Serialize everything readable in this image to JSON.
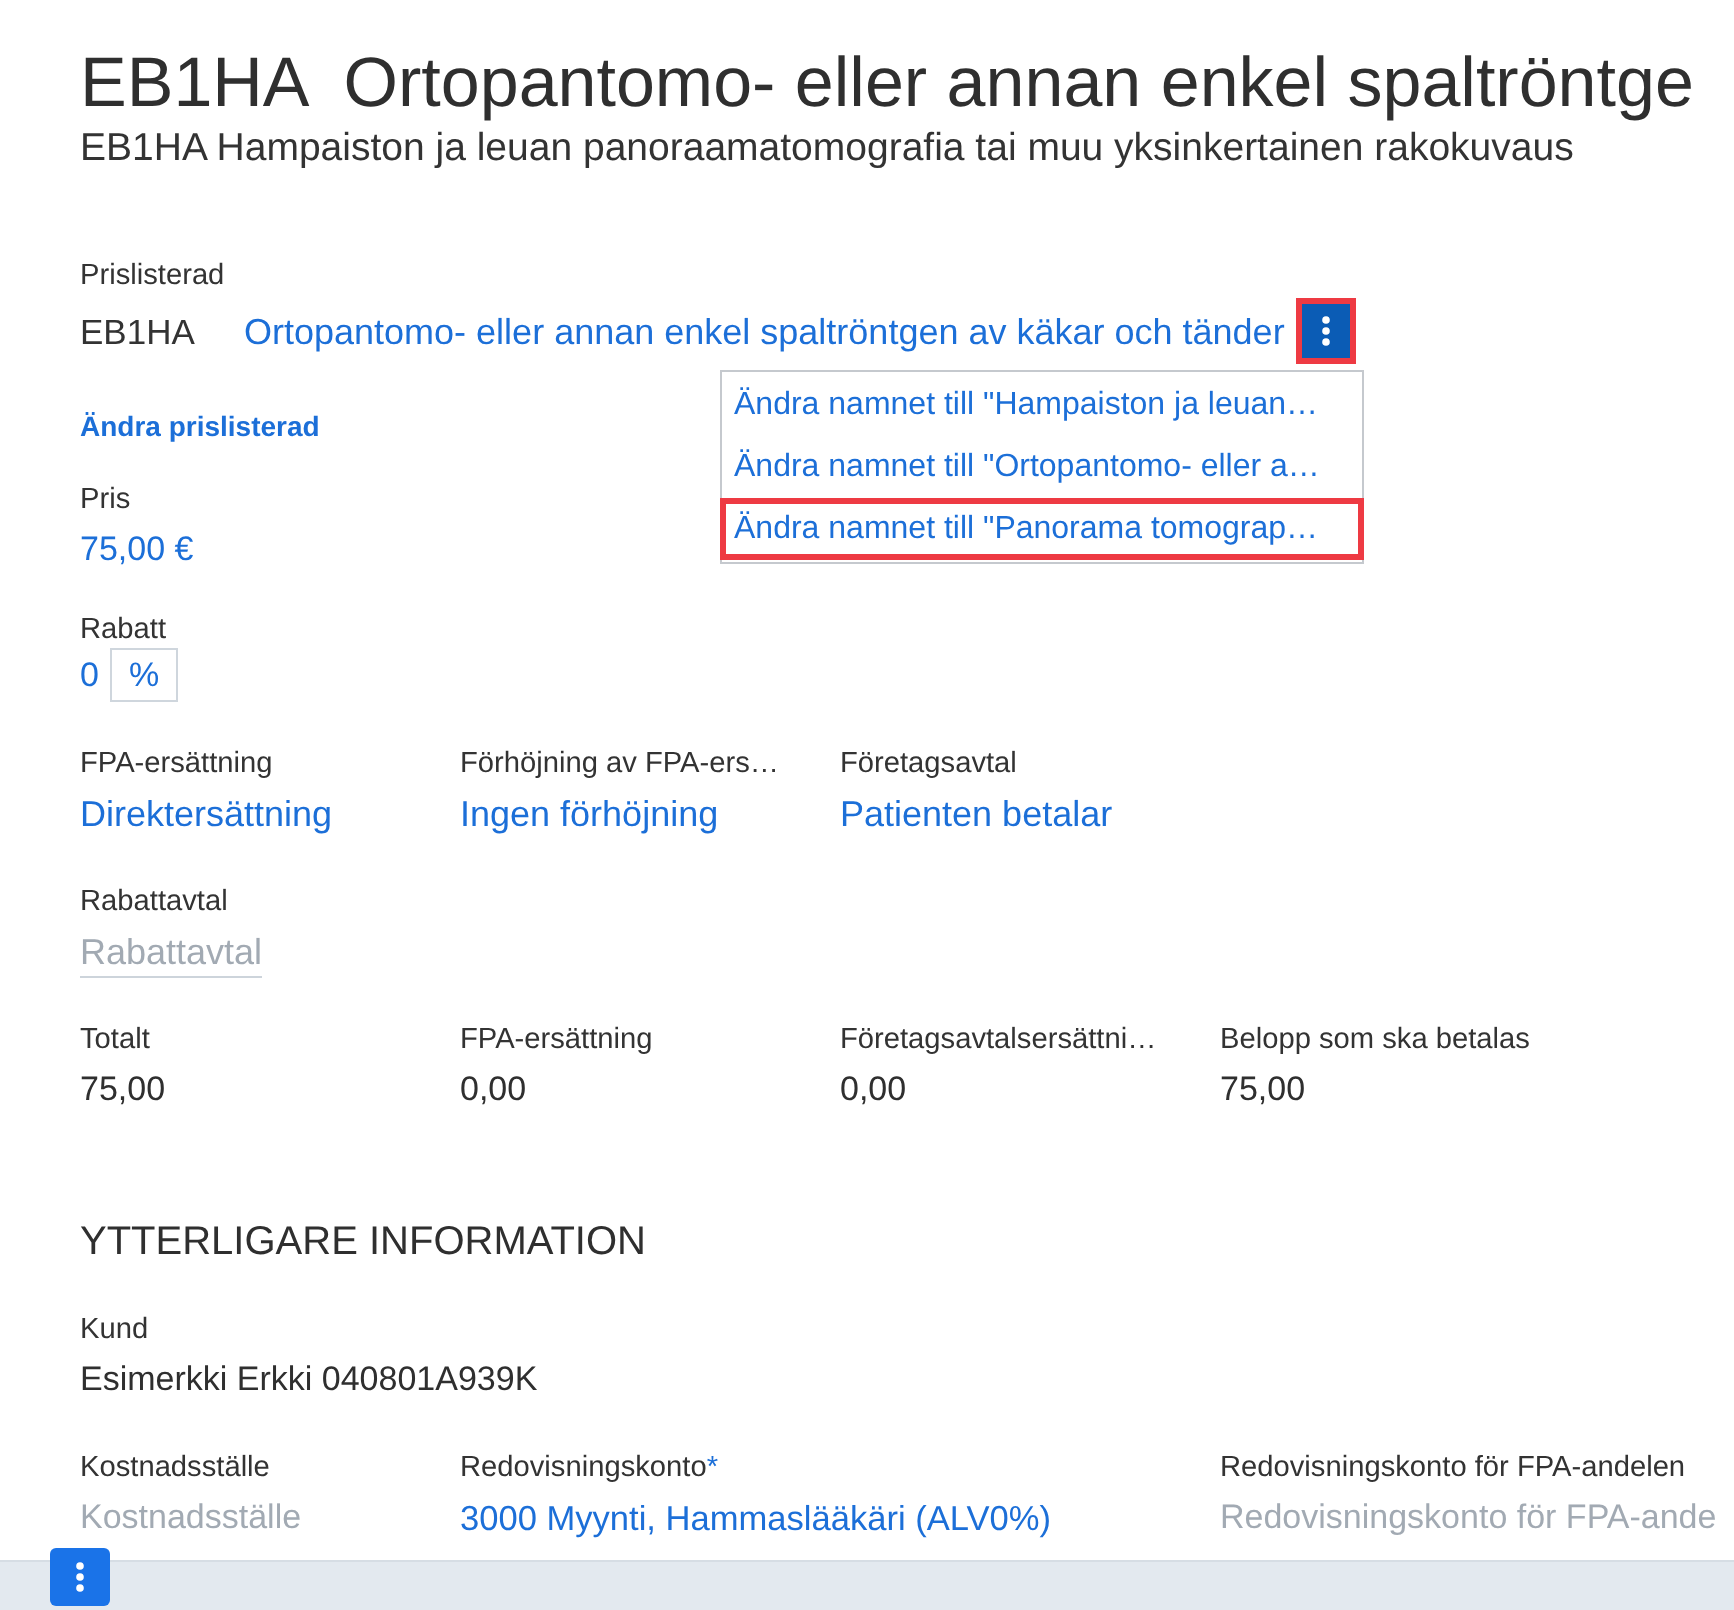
{
  "header": {
    "code": "EB1HA",
    "title": "Ortopantomo- eller annan enkel spaltröntge",
    "subtitle": "EB1HA Hampaiston ja leuan panoraamatomografia tai muu yksinkertainen rakokuvaus"
  },
  "price_list_row": {
    "label": "Prislisterad",
    "code": "EB1HA",
    "name": "Ortopantomo- eller annan enkel spaltröntgen av käkar och tänder",
    "menu_button": {
      "highlighted": true,
      "expanded": true
    },
    "menu": [
      {
        "label": "Ändra namnet till \"Hampaiston ja leuan…",
        "highlighted": false
      },
      {
        "label": "Ändra namnet till \"Ortopantomo- eller a…",
        "highlighted": false
      },
      {
        "label": "Ändra namnet till \"Panorama tomograp…",
        "highlighted": true
      }
    ]
  },
  "change_link": "Ändra prislisterad",
  "price": {
    "label": "Pris",
    "value": "75,00 €"
  },
  "discount": {
    "label": "Rabatt",
    "value": "0",
    "unit": "%"
  },
  "reimbursement_fields": [
    {
      "label": "FPA-ersättning",
      "value": "Direktersättning"
    },
    {
      "label": "Förhöjning av FPA-ers…",
      "value": "Ingen förhöjning"
    },
    {
      "label": "Företagsavtal",
      "value": "Patienten betalar"
    }
  ],
  "discount_agreement": {
    "label": "Rabattavtal",
    "placeholder": "Rabattavtal"
  },
  "totals": [
    {
      "label": "Totalt",
      "value": "75,00"
    },
    {
      "label": "FPA-ersättning",
      "value": "0,00"
    },
    {
      "label": "Företagsavtalsersättni…",
      "value": "0,00"
    },
    {
      "label": "Belopp som ska betalas",
      "value": "75,00"
    }
  ],
  "additional": {
    "heading": "YTTERLIGARE INFORMATION",
    "customer": {
      "label": "Kund",
      "value": "Esimerkki Erkki 040801A939K"
    },
    "fields": [
      {
        "label": "Kostnadsställe",
        "kind": "placeholder",
        "text": "Kostnadsställe"
      },
      {
        "label": "Redovisningskonto",
        "marker": "*",
        "kind": "link",
        "text": "3000 Myynti, Hammaslääkäri (ALV0%)"
      },
      {
        "label": "Redovisningskonto för FPA-andelen",
        "kind": "placeholder",
        "text": "Redovisningskonto för FPA-ande"
      }
    ]
  }
}
